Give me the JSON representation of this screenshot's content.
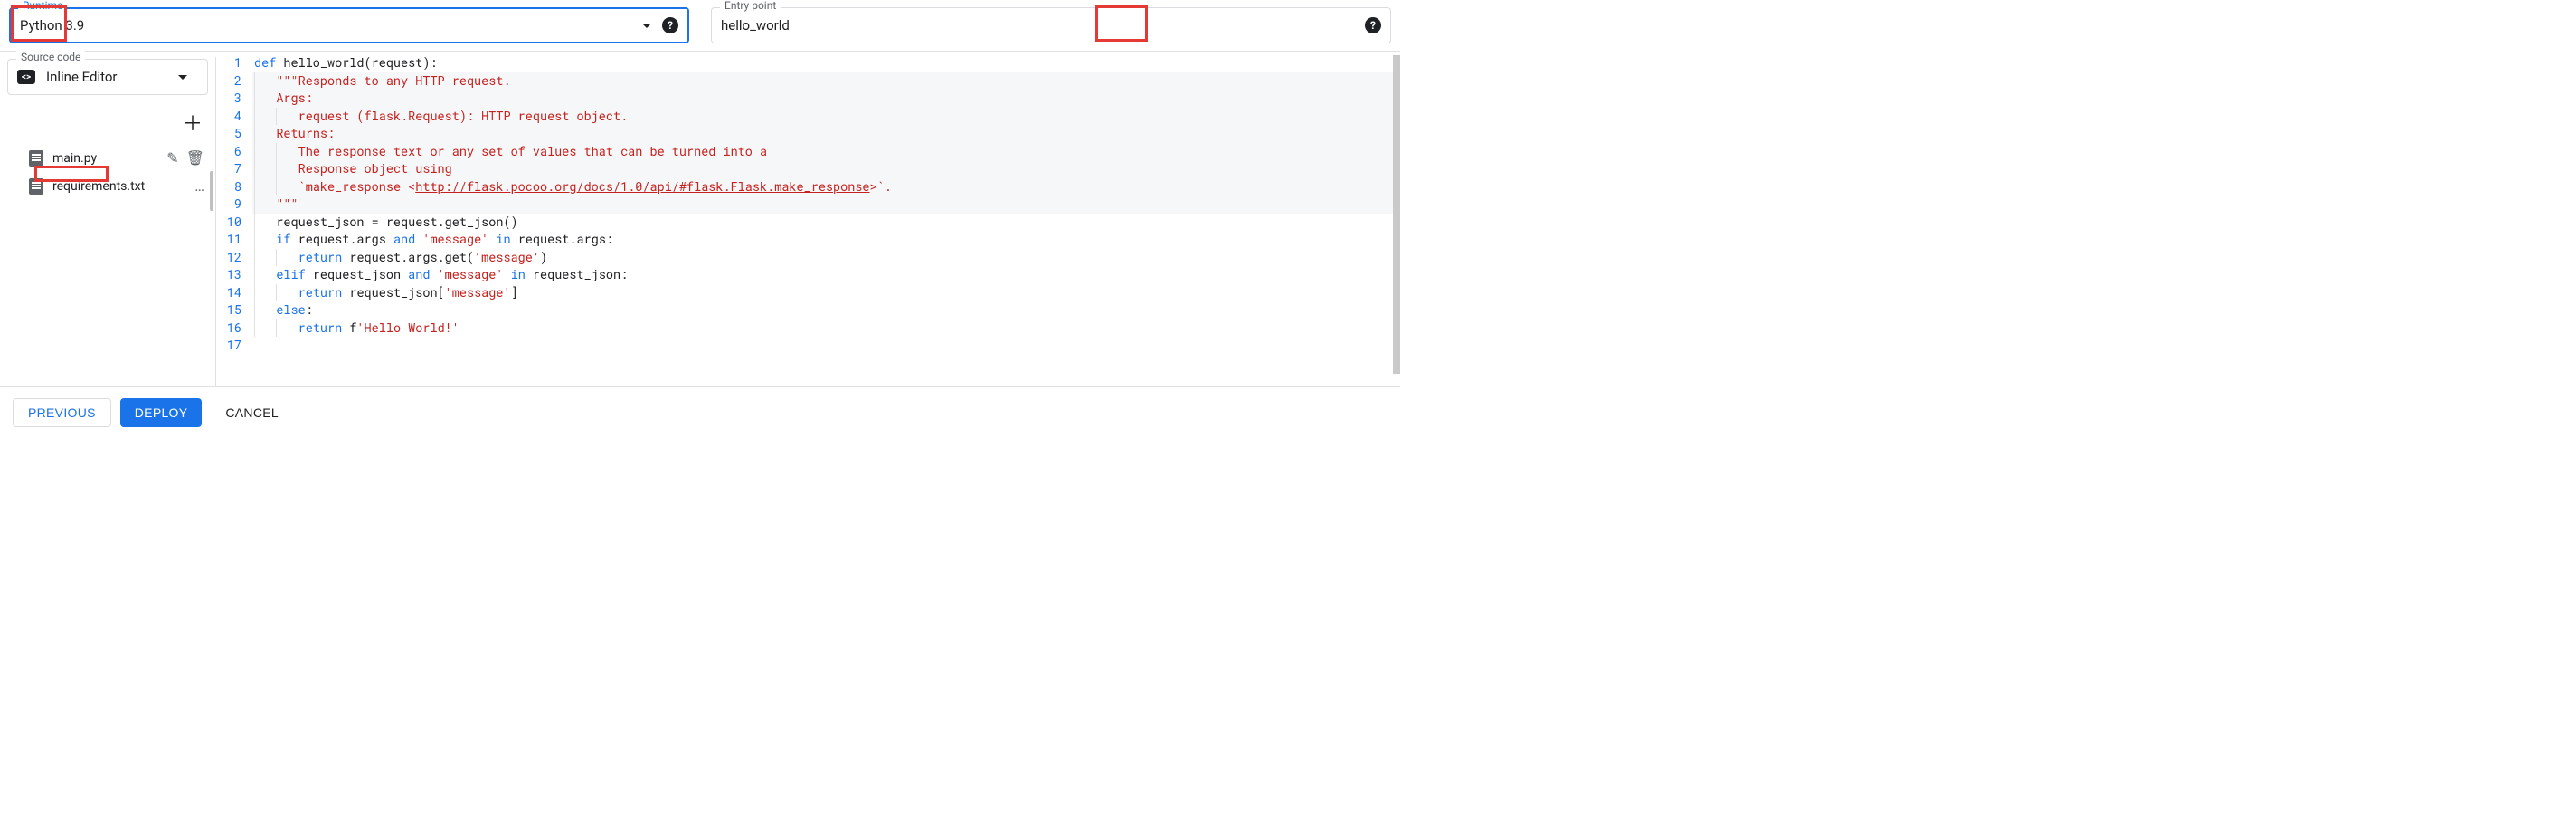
{
  "runtime": {
    "label": "Runtime",
    "value": "Python 3.9"
  },
  "entry_point": {
    "label": "Entry point",
    "value": "hello_world"
  },
  "source_code": {
    "label": "Source code",
    "value": "Inline Editor"
  },
  "files": {
    "items": [
      {
        "name": "main.py",
        "active": true,
        "actions": [
          "edit",
          "delete"
        ]
      },
      {
        "name": "requirements.txt",
        "active": false,
        "actions": [
          "more"
        ]
      }
    ]
  },
  "editor": {
    "line_count": 17,
    "lines": [
      {
        "n": 1,
        "indent": 0,
        "tokens": [
          [
            "kw",
            "def "
          ],
          [
            "def",
            "hello_world(request):"
          ]
        ]
      },
      {
        "n": 2,
        "indent": 1,
        "hl": true,
        "tokens": [
          [
            "str",
            "\"\"\"Responds to any HTTP request."
          ]
        ]
      },
      {
        "n": 3,
        "indent": 1,
        "hl": true,
        "tokens": [
          [
            "str",
            "Args:"
          ]
        ]
      },
      {
        "n": 4,
        "indent": 2,
        "hl": true,
        "tokens": [
          [
            "str",
            "request (flask.Request): HTTP request object."
          ]
        ]
      },
      {
        "n": 5,
        "indent": 1,
        "hl": true,
        "tokens": [
          [
            "str",
            "Returns:"
          ]
        ]
      },
      {
        "n": 6,
        "indent": 2,
        "hl": true,
        "tokens": [
          [
            "str",
            "The response text or any set of values that can be turned into a"
          ]
        ]
      },
      {
        "n": 7,
        "indent": 2,
        "hl": true,
        "tokens": [
          [
            "str",
            "Response object using"
          ]
        ]
      },
      {
        "n": 8,
        "indent": 2,
        "hl": true,
        "tokens": [
          [
            "str",
            "`make_response <"
          ],
          [
            "link",
            "http://flask.pocoo.org/docs/1.0/api/#flask.Flask.make_response"
          ],
          [
            "str",
            ">`."
          ]
        ]
      },
      {
        "n": 9,
        "indent": 1,
        "hl": true,
        "tokens": [
          [
            "str",
            "\"\"\""
          ]
        ]
      },
      {
        "n": 10,
        "indent": 1,
        "tokens": [
          [
            "def",
            "request_json = request.get_json()"
          ]
        ]
      },
      {
        "n": 11,
        "indent": 1,
        "tokens": [
          [
            "kw",
            "if "
          ],
          [
            "def",
            "request.args "
          ],
          [
            "kw",
            "and "
          ],
          [
            "str",
            "'message'"
          ],
          [
            "def",
            " "
          ],
          [
            "kw",
            "in "
          ],
          [
            "def",
            "request.args:"
          ]
        ]
      },
      {
        "n": 12,
        "indent": 2,
        "tokens": [
          [
            "kw",
            "return "
          ],
          [
            "def",
            "request.args.get("
          ],
          [
            "str",
            "'message'"
          ],
          [
            "def",
            ")"
          ]
        ]
      },
      {
        "n": 13,
        "indent": 1,
        "tokens": [
          [
            "kw",
            "elif "
          ],
          [
            "def",
            "request_json "
          ],
          [
            "kw",
            "and "
          ],
          [
            "str",
            "'message'"
          ],
          [
            "def",
            " "
          ],
          [
            "kw",
            "in "
          ],
          [
            "def",
            "request_json:"
          ]
        ]
      },
      {
        "n": 14,
        "indent": 2,
        "tokens": [
          [
            "kw",
            "return "
          ],
          [
            "def",
            "request_json["
          ],
          [
            "str",
            "'message'"
          ],
          [
            "def",
            "]"
          ]
        ]
      },
      {
        "n": 15,
        "indent": 1,
        "tokens": [
          [
            "kw",
            "else"
          ],
          [
            "def",
            ":"
          ]
        ]
      },
      {
        "n": 16,
        "indent": 2,
        "tokens": [
          [
            "kw",
            "return "
          ],
          [
            "def",
            "f"
          ],
          [
            "str",
            "'Hello World!'"
          ]
        ]
      },
      {
        "n": 17,
        "indent": 0,
        "tokens": []
      }
    ]
  },
  "buttons": {
    "previous": "PREVIOUS",
    "deploy": "DEPLOY",
    "cancel": "CANCEL"
  },
  "annotations": {
    "highlighted_fields": [
      "runtime-label",
      "entry-point-label",
      "file-requirements"
    ]
  }
}
